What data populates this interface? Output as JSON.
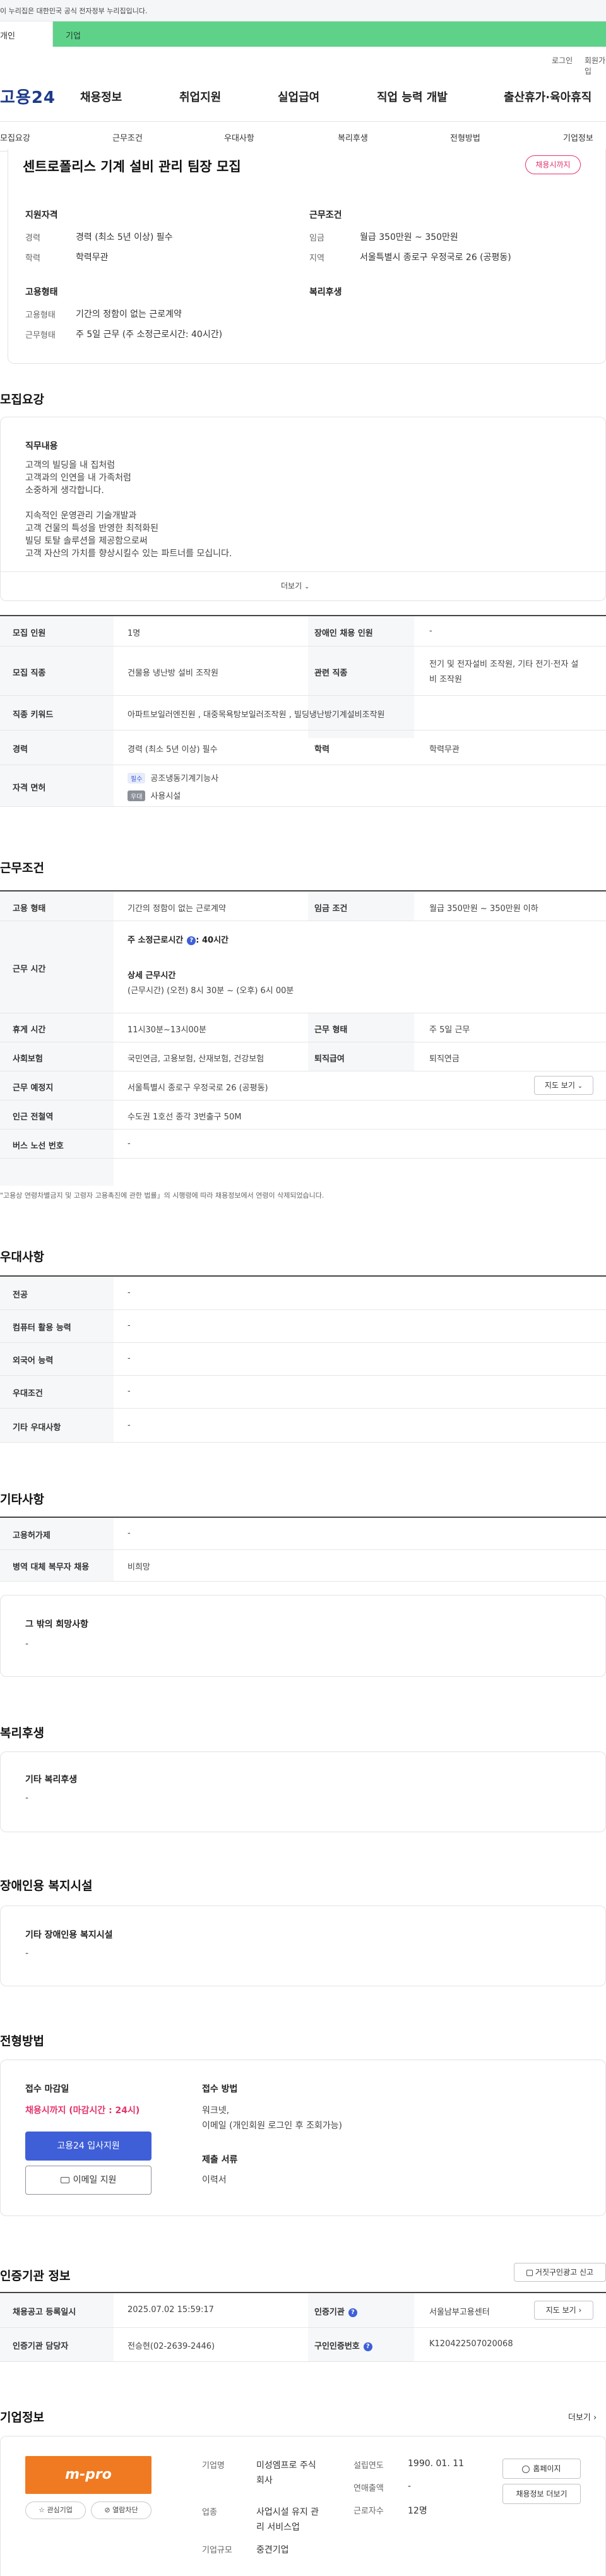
{
  "gov_banner": "이 누리집은 대한민국 공식 전자정부 누리집입니다.",
  "tabs": {
    "individual": "개인",
    "business": "기업"
  },
  "util": {
    "login": "로그인",
    "signup": "회원가입"
  },
  "logo": "고용24",
  "gnb": [
    "채용정보",
    "취업지원",
    "실업급여",
    "직업 능력 개발",
    "출산휴가·육아휴직"
  ],
  "subtabs": [
    "모집요강",
    "근무조건",
    "우대사항",
    "복리후생",
    "전형방법",
    "기업정보"
  ],
  "job": {
    "title": "센트로폴리스 기계 설비 관리 팀장 모집",
    "deadline_badge": "채용시까지"
  },
  "summary": {
    "qual_head": "지원자격",
    "cond_head": "근무조건",
    "type_head": "고용형태",
    "welfare_head": "복리후생",
    "career_k": "경력",
    "career_v": "경력 (최소 5년 이상) 필수",
    "edu_k": "학력",
    "edu_v": "학력무관",
    "wage_k": "임금",
    "wage_v": "월급 350만원 ~ 350만원",
    "loc_k": "지역",
    "loc_v": "서울특별시 종로구 우정국로 26 (공평동)",
    "emp_k": "고용형태",
    "emp_v": "기간의 정함이 없는 근로계약",
    "work_k": "근무형태",
    "work_v": "주 5일 근무 (주 소정근로시간: 40시간)"
  },
  "recruit": {
    "section_title": "모집요강",
    "duty_head": "직무내용",
    "duty_lines": [
      "고객의 빌딩을 내 집처럼",
      "고객과의 인연을 내 가족처럼",
      "소중하게 생각합니다.",
      "",
      "지속적인 운영관리 기술개발과",
      "고객 건물의 특성을 반영한 최적화된",
      "빌딩 토탈 솔루션을 제공함으로써",
      "고객 자산의 가치를 향상시킬수 있는 파트너를 모십니다."
    ],
    "more_label": "더보기",
    "count_th": "모집 인원",
    "count_v": "1명",
    "disabled_th": "장애인 채용 인원",
    "disabled_v": "-",
    "job_th": "모집 직종",
    "job_v": "건물용 냉난방 설비 조작원",
    "rel_th": "관련 직종",
    "rel_v1": "전기 및 전자설비 조작원, 기타 전기·전자 설",
    "rel_v2": "비 조작원",
    "kw_th": "직종 키워드",
    "kw_v": "아파트보일러엔진원 , 대중목욕탕보일러조작원 , 빌딩냉난방기계설비조작원",
    "career_th": "경력",
    "career_v": "경력 (최소 5년 이상) 필수",
    "edu_th": "학력",
    "edu_v": "학력무관",
    "cert_th": "자격 면허",
    "cert_req_tag": "필수",
    "cert_req": "공조냉동기계기능사",
    "cert_opt_tag": "우대",
    "cert_opt": "사용시설"
  },
  "conditions": {
    "section_title": "근무조건",
    "emp_th": "고용 형태",
    "emp_v": "기간의 정함이 없는 근로계약",
    "wage_th": "임금 조건",
    "wage_v": "월급 350만원 ~ 350만원 이하",
    "time_th": "근무 시간",
    "time_weekly": "주 소정근로시간",
    "time_weekly_v": ": 40시간",
    "time_detail_head": "상세 근무시간",
    "time_detail": "(근무시간) (오전) 8시 30분 ~ (오후) 6시 00분",
    "break_th": "휴게 시간",
    "break_v": "11시30분~13시00분",
    "shape_th": "근무 형태",
    "shape_v": "주 5일 근무",
    "ins_th": "사회보험",
    "ins_v": "국민연금, 고용보험, 산재보험, 건강보험",
    "ret_th": "퇴직급여",
    "ret_v": "퇴직연금",
    "place_th": "근무 예정지",
    "place_v": "서울특별시 종로구 우정국로 26 (공평동)",
    "map_btn": "지도 보기",
    "subway_th": "인근 전철역",
    "subway_v": "수도권 1호선 종각 3번출구 50M",
    "bus_th": "버스 노선 번호",
    "bus_v": "-",
    "note": "\"고용상 연령차별금지 및 고령자 고용촉진에 관한 법률」의 시행령에 따라 채용정보에서 연령이 삭제되었습니다."
  },
  "pref": {
    "section_title": "우대사항",
    "rows": [
      {
        "th": "전공",
        "v": "-"
      },
      {
        "th": "컴퓨터 활용 능력",
        "v": "-"
      },
      {
        "th": "외국어 능력",
        "v": "-"
      },
      {
        "th": "우대조건",
        "v": "-"
      },
      {
        "th": "기타 우대사항",
        "v": "-"
      }
    ]
  },
  "etc": {
    "section_title": "기타사항",
    "hire_th": "고용허가제",
    "hire_v": "-",
    "mil_th": "병역 대체 복무자 채용",
    "mil_v": "비희망",
    "other_head": "그 밖의 희망사항",
    "other_v": "-"
  },
  "welfare": {
    "section_title": "복리후생",
    "head": "기타 복리후생",
    "v": "-"
  },
  "disability": {
    "section_title": "장애인용 복지시설",
    "head": "기타 장애인용 복지시설",
    "v": "-"
  },
  "process": {
    "section_title": "전형방법",
    "deadline_head": "접수 마감일",
    "deadline_v": "채용시까지 (마감시간 : 24시)",
    "apply_btn": "고용24 입사지원",
    "email_btn": "이메일 지원",
    "method_head": "접수 방법",
    "method_v1": "워크넷,",
    "method_v2": "이메일 (개인회원 로그인 후 조회가능)",
    "docs_head": "제출 서류",
    "docs_v": "이력서"
  },
  "agency": {
    "section_title": "인증기관 정보",
    "report_btn": "거짓구인광고 신고",
    "reg_th": "채용공고 등록일시",
    "reg_v": "2025.07.02 15:59:17",
    "org_th": "인증기관",
    "org_v": "서울남부고용센터",
    "map_btn": "지도 보기",
    "mgr_th": "인증기관 담당자",
    "mgr_v": "전승현(02-2639-2446)",
    "no_th": "구인인증번호",
    "no_v": "K120422507020068"
  },
  "company": {
    "section_title": "기업정보",
    "more": "더보기",
    "logo_text": "m-pro",
    "fav_btn": "관심기업",
    "block_btn": "열람차단",
    "name_k": "기업명",
    "name_v1": "미성엠프로 주식",
    "name_v2": "회사",
    "ind_k": "업종",
    "ind_v1": "사업시설 유지 관",
    "ind_v2": "리 서비스업",
    "size_k": "기업규모",
    "size_v": "중견기업",
    "est_k": "설립연도",
    "est_v": "1990. 01. 11",
    "sales_k": "연매출액",
    "sales_v": "-",
    "emp_k": "근로자수",
    "emp_v": "12명",
    "home_btn": "홈페이지",
    "jobs_btn": "채용정보 더보기"
  },
  "colors": {
    "brand_green": "#5fd28a",
    "brand_blue": "#3f5fd8",
    "deadline_red": "#e5336b",
    "logo_orange": "#f07a22"
  }
}
